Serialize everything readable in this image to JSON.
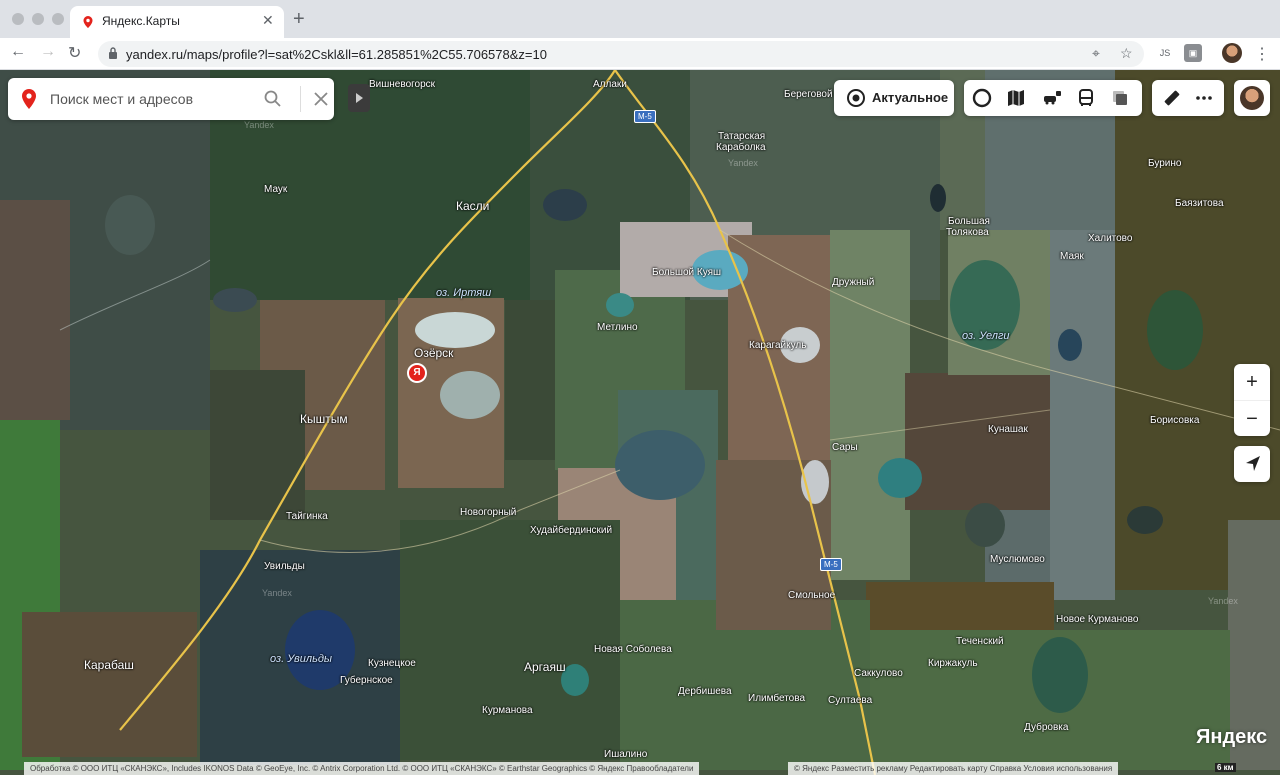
{
  "browser": {
    "tab_title": "Яндекс.Карты",
    "url": "yandex.ru/maps/profile?l=sat%2Cskl&ll=61.285851%2C55.706578&z=10",
    "extension_label": "JS"
  },
  "map": {
    "search_placeholder": "Поиск мест и адресов",
    "actual_label": "Актуальное",
    "zoom_in": "+",
    "zoom_out": "−",
    "marker_letter": "Я",
    "logo": "Яндекс",
    "scale": "6 км",
    "attribution_left": "Обработка © ООО ИТЦ «СКАНЭКС», Includes IKONOS Data © GeoEye, Inc. © Antrix Corporation Ltd. © ООО ИТЦ «СКАНЭКС» © Earthstar Geographics © Яндекс  Правообладатели",
    "attribution_right": "© Яндекс   Разместить рекламу   Редактировать карту   Справка   Условия использования",
    "watermark": "Yandex",
    "road": "M-5",
    "places": {
      "vishnevogorsk": "Вишневогорск",
      "allaki": "Аллаки",
      "beregovoy": "Береговой",
      "tatarskaya": "Татарская",
      "karabolka": "Караболка",
      "buryino": "Бурино",
      "mauk": "Маук",
      "kasli": "Касли",
      "bayazitova": "Баязитова",
      "bolshaya": "Большая",
      "tolyakova": "Толякова",
      "khalitovo": "Халитово",
      "bolshoy_kuyash": "Большой Куяш",
      "druzhny": "Дружный",
      "mayak": "Маяк",
      "ozersk": "Озёрск",
      "metlino": "Метлино",
      "karagaykul": "Карагайкуль",
      "kyshtym": "Кыштым",
      "kunashak": "Кунашак",
      "borisovka": "Борисовка",
      "sary": "Сары",
      "tayginka": "Тайгинка",
      "novogorny": "Новогорный",
      "khudayberdinsky": "Худайбердинский",
      "muslyumovo": "Муслюмово",
      "uvildy": "Увильды",
      "smolnoe": "Смольное",
      "novoe_kurmanovo": "Новое Курманово",
      "techensky": "Теченский",
      "karabash": "Карабаш",
      "kuznetskoe": "Кузнецкое",
      "argayash": "Аргаяш",
      "novaya_sobolevo": "Новая Соболева",
      "sakkulovo": "Саккулово",
      "kirzhakul": "Киржакуль",
      "gubernskoe": "Губернское",
      "derbisheva": "Дербишева",
      "ilimbetova": "Илимбетова",
      "sultaeva": "Султаева",
      "kurmanova": "Курманова",
      "dubrovka": "Дубровка",
      "ishalino": "Ишалино"
    },
    "lakes": {
      "irtyash": "оз. Иртяш",
      "uelgi": "оз. Уелги",
      "uvildy": "оз. Увильды"
    }
  }
}
